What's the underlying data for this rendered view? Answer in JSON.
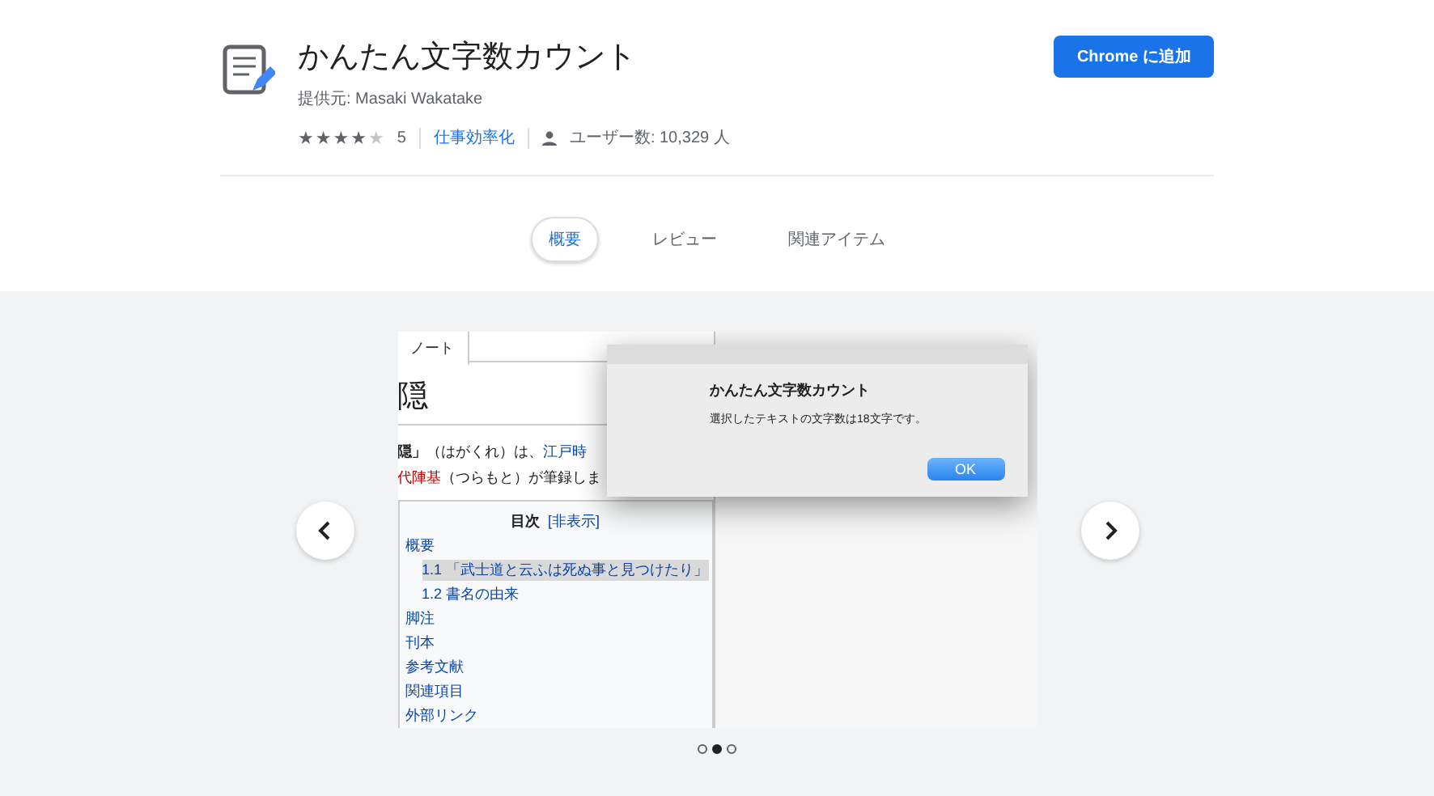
{
  "header": {
    "title": "かんたん文字数カウント",
    "provider": "提供元: Masaki Wakatake",
    "stars": 4,
    "rating_count": "5",
    "category": "仕事効率化",
    "users": "ユーザー数: 10,329 人",
    "add_button": "Chrome に追加"
  },
  "tabs": [
    {
      "label": "概要",
      "selected": true
    },
    {
      "label": "レビュー",
      "selected": false
    },
    {
      "label": "関連アイテム",
      "selected": false
    }
  ],
  "screenshot": {
    "page_tab": "ノート",
    "heading": "隠",
    "lead": [
      {
        "kind": "bold",
        "text": "隠」"
      },
      {
        "kind": "plain",
        "text": "（はがくれ）は、"
      },
      {
        "kind": "link",
        "text": "江戸時"
      }
    ],
    "lead2": [
      {
        "kind": "red",
        "text": "代陣基"
      },
      {
        "kind": "plain",
        "text": "（つらもと）が筆録しま"
      }
    ],
    "toc": {
      "title": "目次",
      "toggle": "[非表示]",
      "items": [
        {
          "label": "概要",
          "selected": false,
          "children": [
            {
              "label": "1.1 「武士道と云ふは死ぬ事と見つけたり」",
              "selected": true
            },
            {
              "label": "1.2 書名の由来",
              "selected": false
            }
          ]
        },
        {
          "label": "脚注",
          "selected": false
        },
        {
          "label": "刊本",
          "selected": false
        },
        {
          "label": "参考文献",
          "selected": false
        },
        {
          "label": "関連項目",
          "selected": false
        },
        {
          "label": "外部リンク",
          "selected": false
        }
      ]
    },
    "dialog": {
      "title": "かんたん文字数カウント",
      "message": "選択したテキストの文字数は18文字です。",
      "button": "OK"
    }
  },
  "carousel_dots": [
    {
      "selected": false
    },
    {
      "selected": true
    },
    {
      "selected": false
    }
  ]
}
